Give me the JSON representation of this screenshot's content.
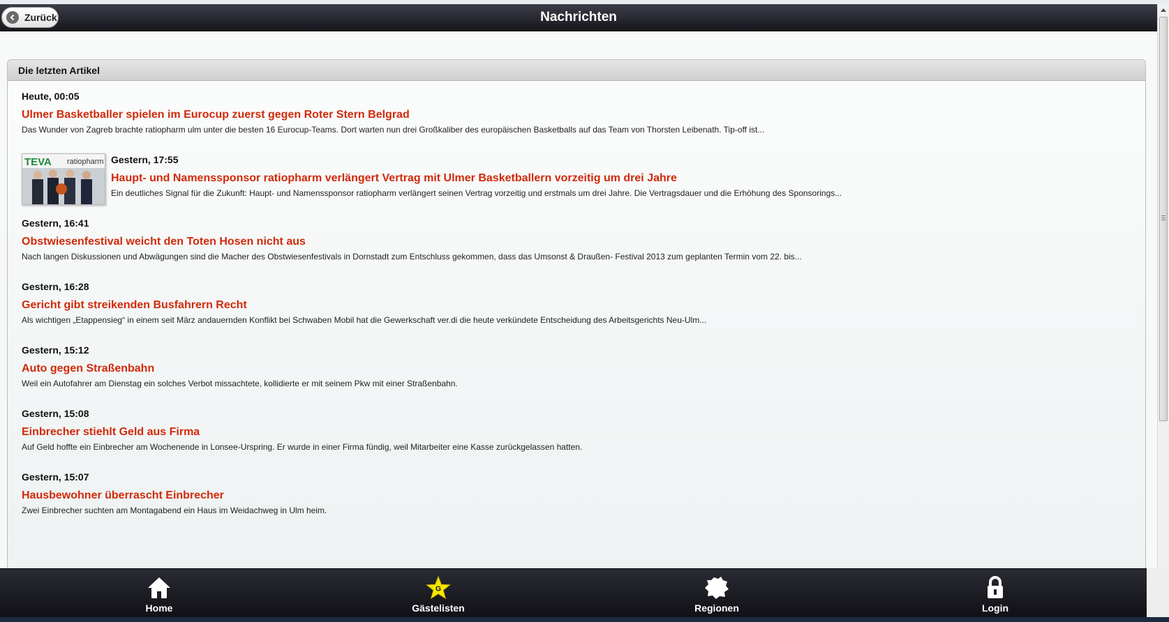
{
  "header": {
    "back_label": "Zurück",
    "title": "Nachrichten"
  },
  "panel": {
    "heading": "Die letzten Artikel"
  },
  "articles": [
    {
      "date": "Heute, 00:05",
      "title": "Ulmer Basketballer spielen im Eurocup zuerst gegen Roter Stern Belgrad",
      "text": "Das Wunder von Zagreb brachte ratiopharm ulm unter die besten 16 Eurocup-Teams. Dort warten nun drei Großkaliber des europäischen Basketballs auf das Team von Thorsten Leibenath. Tip-off ist...",
      "has_image": false
    },
    {
      "date": "Gestern, 17:55",
      "title": "Haupt- und Namenssponsor ratiopharm verlängert Vertrag mit Ulmer Basketballern vorzeitig um drei Jahre",
      "text": "Ein deutliches Signal für die Zukunft: Haupt- und Namenssponsor ratiopharm verlängert seinen Vertrag vorzeitig und erstmals um drei Jahre. Die Vertragsdauer und die Erhöhung des Sponsorings...",
      "has_image": true,
      "image_logo_left": "TEVA",
      "image_logo_right": "ratiopharm"
    },
    {
      "date": "Gestern, 16:41",
      "title": "Obstwiesenfestival weicht den Toten Hosen nicht aus",
      "text": "Nach langen Diskussionen und Abwägungen sind die Macher des Obstwiesenfestivals in Dornstadt zum Entschluss gekommen, dass das Umsonst & Draußen- Festival 2013 zum geplanten Termin vom 22. bis...",
      "has_image": false
    },
    {
      "date": "Gestern, 16:28",
      "title": "Gericht gibt streikenden Busfahrern Recht",
      "text": " Als wichtigen „Etappensieg“ in einem seit März andauernden Konflikt bei Schwaben Mobil hat die Gewerkschaft ver.di die heute verkündete Entscheidung des Arbeitsgerichts Neu-Ulm...",
      "has_image": false
    },
    {
      "date": "Gestern, 15:12",
      "title": "Auto gegen Straßenbahn",
      "text": " Weil ein Autofahrer am Dienstag ein solches Verbot missachtete, kollidierte er mit seinem Pkw mit einer Straßenbahn.",
      "has_image": false
    },
    {
      "date": "Gestern, 15:08",
      "title": "Einbrecher stiehlt Geld aus Firma",
      "text": "Auf Geld hoffte ein Einbrecher am Wochenende in Lonsee-Urspring. Er wurde in einer Firma fündig, weil Mitarbeiter eine Kasse zurückgelassen hatten.",
      "has_image": false
    },
    {
      "date": "Gestern, 15:07",
      "title": "Hausbewohner überrascht Einbrecher",
      "text": " Zwei Einbrecher suchten am Montagabend ein Haus im Weidachweg in Ulm heim.",
      "has_image": false
    }
  ],
  "tabbar": {
    "items": [
      {
        "label": "Home",
        "icon": "home-icon"
      },
      {
        "label": "Gästelisten",
        "icon": "star-g-icon",
        "icon_letter": "G",
        "icon_color": "#f6e600"
      },
      {
        "label": "Regionen",
        "icon": "region-map-icon"
      },
      {
        "label": "Login",
        "icon": "lock-icon"
      }
    ]
  },
  "colors": {
    "accent_title": "#d12a0a",
    "header_bg": "#1e1e26"
  }
}
